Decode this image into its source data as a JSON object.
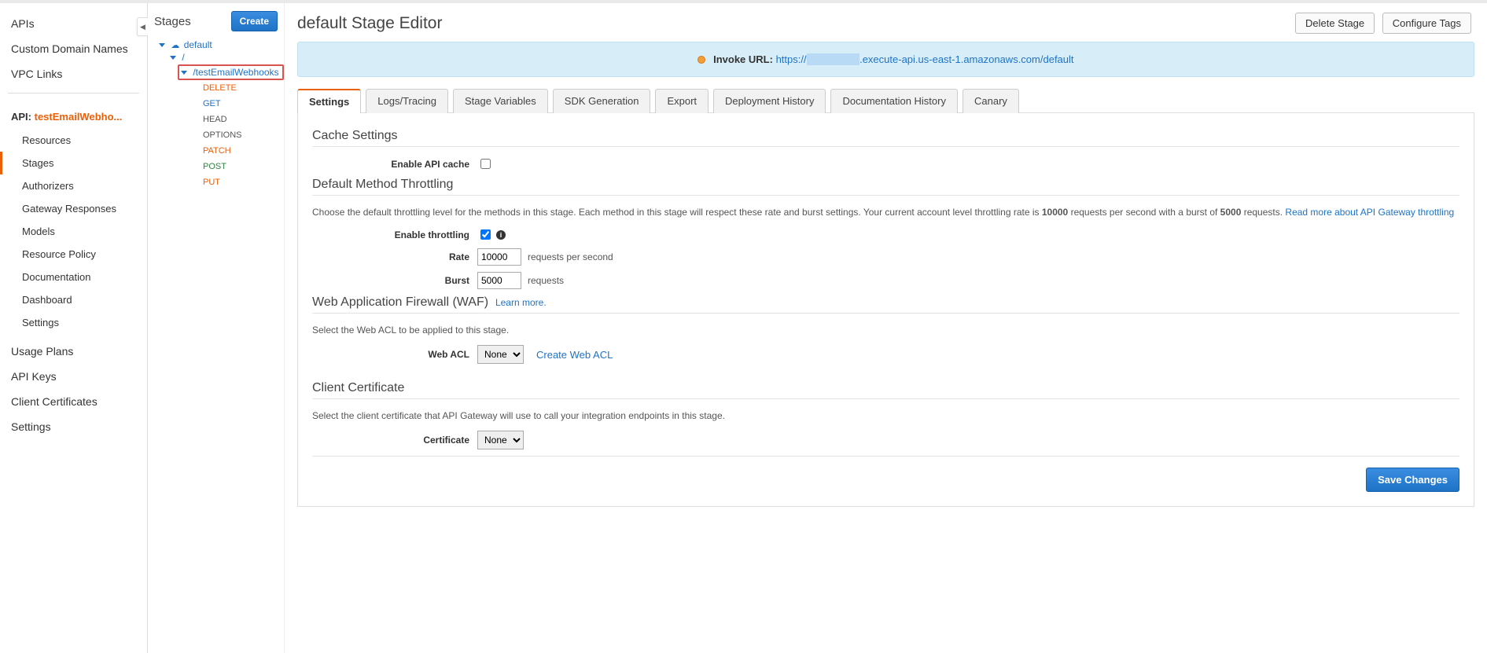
{
  "primaryNav": {
    "items": [
      "APIs",
      "Custom Domain Names",
      "VPC Links"
    ],
    "apiLabelPrefix": "API:",
    "apiName": "testEmailWebho...",
    "sub": [
      "Resources",
      "Stages",
      "Authorizers",
      "Gateway Responses",
      "Models",
      "Resource Policy",
      "Documentation",
      "Dashboard",
      "Settings"
    ],
    "activeSub": "Stages",
    "bottom": [
      "Usage Plans",
      "API Keys",
      "Client Certificates",
      "Settings"
    ]
  },
  "tree": {
    "title": "Stages",
    "createLabel": "Create",
    "root": "default",
    "slash": "/",
    "highlighted": "/testEmailWebhooks",
    "methods": [
      "DELETE",
      "GET",
      "HEAD",
      "OPTIONS",
      "PATCH",
      "POST",
      "PUT"
    ]
  },
  "main": {
    "title": "default Stage Editor",
    "deleteStage": "Delete Stage",
    "configureTags": "Configure Tags",
    "invoke": {
      "label": "Invoke URL:",
      "urlPrefix": "https://",
      "urlSuffix": ".execute-api.us-east-1.amazonaws.com/default"
    },
    "tabs": [
      "Settings",
      "Logs/Tracing",
      "Stage Variables",
      "SDK Generation",
      "Export",
      "Deployment History",
      "Documentation History",
      "Canary"
    ],
    "activeTab": "Settings",
    "cache": {
      "title": "Cache Settings",
      "enableLabel": "Enable API cache",
      "checked": false
    },
    "throttling": {
      "title": "Default Method Throttling",
      "para1a": "Choose the default throttling level for the methods in this stage. Each method in this stage will respect these rate and burst settings. Your current account level throttling rate is ",
      "rateBold": "10000",
      "para1b": " requests per second with a burst of ",
      "burstBold": "5000",
      "para1c": " requests. ",
      "readMore": "Read more about API Gateway throttling",
      "enableLabel": "Enable throttling",
      "checked": true,
      "rateLabel": "Rate",
      "rateValue": "10000",
      "rateUnit": "requests per second",
      "burstLabel": "Burst",
      "burstValue": "5000",
      "burstUnit": "requests"
    },
    "waf": {
      "title": "Web Application Firewall (WAF)",
      "learnMore": "Learn more.",
      "desc": "Select the Web ACL to be applied to this stage.",
      "aclLabel": "Web ACL",
      "aclValue": "None",
      "createLink": "Create Web ACL"
    },
    "cert": {
      "title": "Client Certificate",
      "desc": "Select the client certificate that API Gateway will use to call your integration endpoints in this stage.",
      "label": "Certificate",
      "value": "None"
    },
    "save": "Save Changes"
  }
}
